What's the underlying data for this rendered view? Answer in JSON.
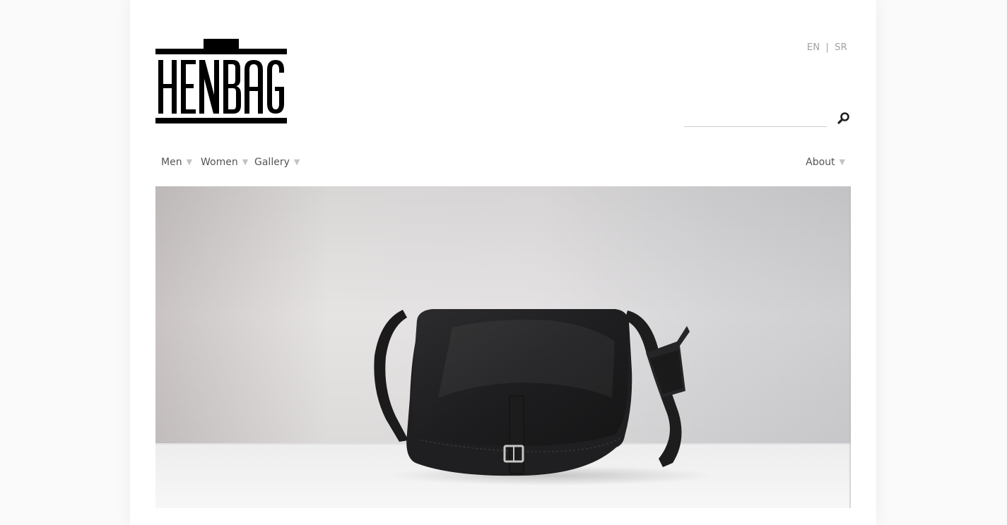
{
  "brand": {
    "logo_text": "HENBAG"
  },
  "header": {
    "languages": [
      {
        "code": "EN"
      },
      {
        "code": "SR"
      }
    ],
    "lang_separator": "|"
  },
  "search": {
    "value": "",
    "placeholder": "",
    "button_icon": "search-icon"
  },
  "nav": {
    "left_items": [
      {
        "label": "Men",
        "has_dropdown": true
      },
      {
        "label": "Women",
        "has_dropdown": true
      },
      {
        "label": "Gallery",
        "has_dropdown": true
      }
    ],
    "right_items": [
      {
        "label": "About",
        "has_dropdown": true
      }
    ],
    "dropdown_icon": "caret-down-icon"
  },
  "hero": {
    "subject": "black leather messenger bag"
  },
  "colors": {
    "page_bg": "#fafafa",
    "content_bg": "#ffffff",
    "text": "#555555",
    "muted": "#a0a0a0",
    "logo": "#000000"
  }
}
